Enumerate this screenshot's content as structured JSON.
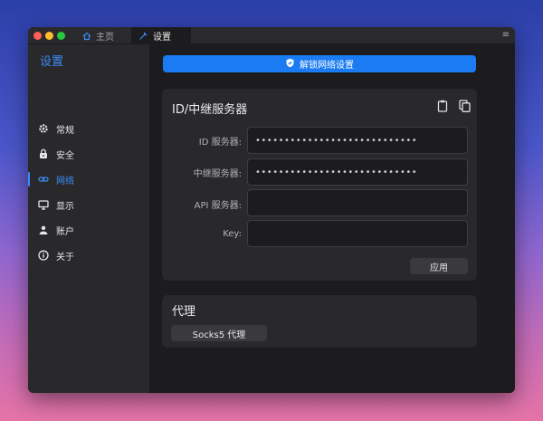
{
  "window": {
    "tabs": [
      {
        "label": "主页",
        "icon": "home-icon"
      },
      {
        "label": "设置",
        "icon": "wrench-icon"
      }
    ]
  },
  "sidebar": {
    "title": "设置",
    "items": [
      {
        "label": "常规",
        "icon": "gear-icon",
        "active": false
      },
      {
        "label": "安全",
        "icon": "lock-icon",
        "active": false
      },
      {
        "label": "网络",
        "icon": "link-icon",
        "active": true
      },
      {
        "label": "显示",
        "icon": "monitor-icon",
        "active": false
      },
      {
        "label": "账户",
        "icon": "user-icon",
        "active": false
      },
      {
        "label": "关于",
        "icon": "info-icon",
        "active": false
      }
    ]
  },
  "main": {
    "unlock_button": "解锁网络设置",
    "id_relay": {
      "title": "ID/中继服务器",
      "fields": [
        {
          "label": "ID 服务器:",
          "value": "••••••••••••••••••••••••••••"
        },
        {
          "label": "中继服务器:",
          "value": "••••••••••••••••••••••••••••"
        },
        {
          "label": "API 服务器:",
          "value": ""
        },
        {
          "label": "Key:",
          "value": ""
        }
      ],
      "apply_button": "应用"
    },
    "proxy": {
      "title": "代理",
      "socks_button": "Socks5 代理"
    }
  },
  "colors": {
    "accent": "#3b8cf7",
    "primary_button": "#1a7bf2",
    "window_bg": "#1c1c1e",
    "card_bg": "#29292b"
  }
}
